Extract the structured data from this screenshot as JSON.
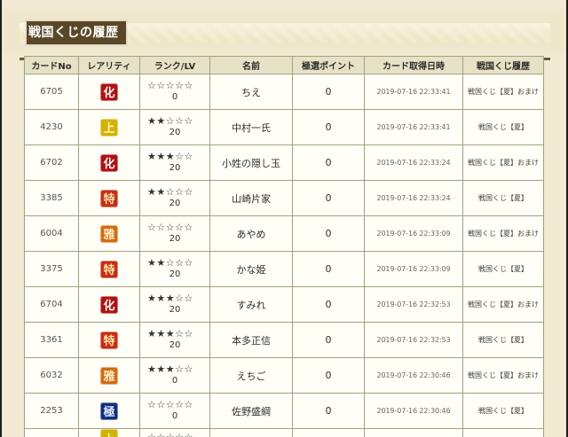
{
  "header": {
    "title": "戦国くじの履歴"
  },
  "table": {
    "columns": [
      "カードNo",
      "レアリティ",
      "ランク/LV",
      "名前",
      "極選ポイント",
      "カード取得日時",
      "戦国くじ履歴"
    ],
    "rows": [
      {
        "id": "6705",
        "rarity": "化",
        "stars": "☆☆☆☆☆",
        "level": "0",
        "name": "ちえ",
        "points": "0",
        "date": "2019-07-16 22:33:41",
        "history": "戦国くじ【夏】おまけ"
      },
      {
        "id": "4230",
        "rarity": "上",
        "stars": "★★☆☆☆",
        "level": "20",
        "name": "中村一氏",
        "points": "0",
        "date": "2019-07-16 22:33:41",
        "history": "戦国くじ【夏】"
      },
      {
        "id": "6702",
        "rarity": "化",
        "stars": "★★★☆☆",
        "level": "20",
        "name": "小姓の隠し玉",
        "points": "0",
        "date": "2019-07-16 22:33:24",
        "history": "戦国くじ【夏】おまけ"
      },
      {
        "id": "3385",
        "rarity": "特",
        "stars": "★★☆☆☆",
        "level": "20",
        "name": "山崎片家",
        "points": "0",
        "date": "2019-07-16 22:33:24",
        "history": "戦国くじ【夏】"
      },
      {
        "id": "6004",
        "rarity": "雅",
        "stars": "☆☆☆☆☆",
        "level": "20",
        "name": "あやめ",
        "points": "0",
        "date": "2019-07-16 22:33:09",
        "history": "戦国くじ【夏】おまけ"
      },
      {
        "id": "3375",
        "rarity": "特",
        "stars": "★★☆☆☆",
        "level": "20",
        "name": "かな姫",
        "points": "0",
        "date": "2019-07-16 22:33:09",
        "history": "戦国くじ【夏】"
      },
      {
        "id": "6704",
        "rarity": "化",
        "stars": "★★★☆☆",
        "level": "20",
        "name": "すみれ",
        "points": "0",
        "date": "2019-07-16 22:32:53",
        "history": "戦国くじ【夏】おまけ"
      },
      {
        "id": "3361",
        "rarity": "特",
        "stars": "★★★☆☆",
        "level": "20",
        "name": "本多正信",
        "points": "0",
        "date": "2019-07-16 22:32:53",
        "history": "戦国くじ【夏】"
      },
      {
        "id": "6032",
        "rarity": "雅",
        "stars": "★★★☆☆",
        "level": "0",
        "name": "えちご",
        "points": "0",
        "date": "2019-07-16 22:30:46",
        "history": "戦国くじ【夏】おまけ"
      },
      {
        "id": "2253",
        "rarity": "極",
        "stars": "☆☆☆☆☆",
        "level": "0",
        "name": "佐野盛綱",
        "points": "0",
        "date": "2019-07-16 22:30:46",
        "history": "戦国くじ【夏】"
      },
      {
        "id": "",
        "rarity": "上",
        "stars": "☆☆☆☆☆",
        "level": "",
        "name": "",
        "points": "",
        "date": "",
        "history": ""
      }
    ]
  },
  "colors": {
    "background": "#f0ead2",
    "header_label": "#5a4728",
    "table_border": "#a5a07f",
    "table_header": "#e7e2c5",
    "row_background": "#fffef7"
  }
}
